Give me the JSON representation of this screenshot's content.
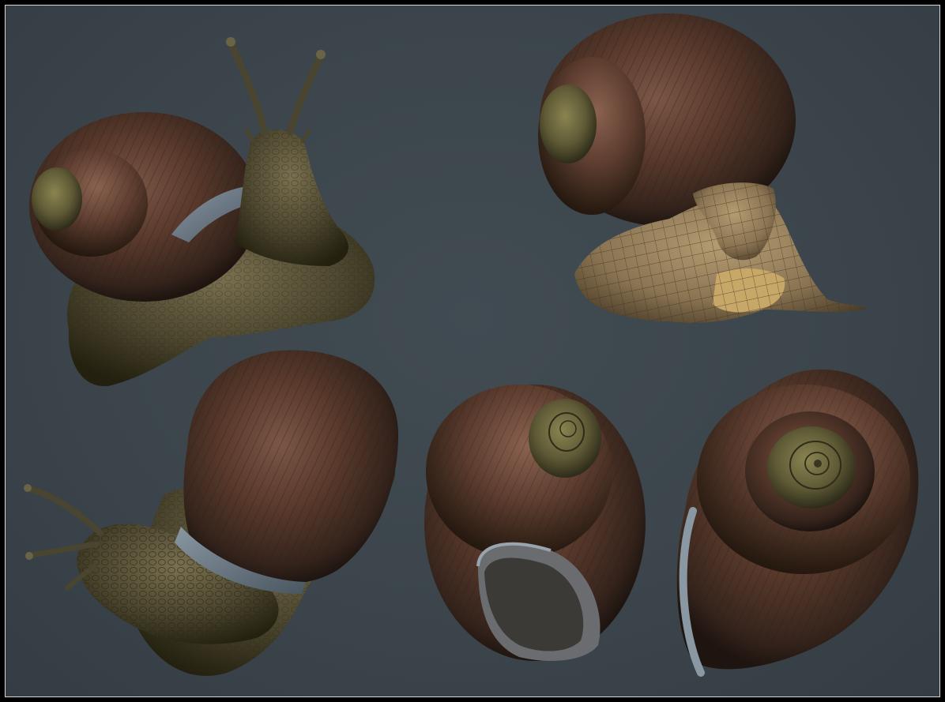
{
  "image": {
    "background_color": "#3c464c",
    "frame_border_color": "#d8d8d8",
    "subjects": [
      "snail-render-front-view",
      "snail-render-wireframe-back-view",
      "snail-render-side-view",
      "snail-shell-aperture-view",
      "snail-shell-spiral-view"
    ],
    "colors": {
      "shell_brown": "#5a3a2c",
      "shell_dark": "#2a1c16",
      "body_olive": "#5a5436",
      "body_dark": "#2e2a1c",
      "wireframe_tan": "#a08a62",
      "wireframe_yellow": "#c8a868"
    }
  }
}
